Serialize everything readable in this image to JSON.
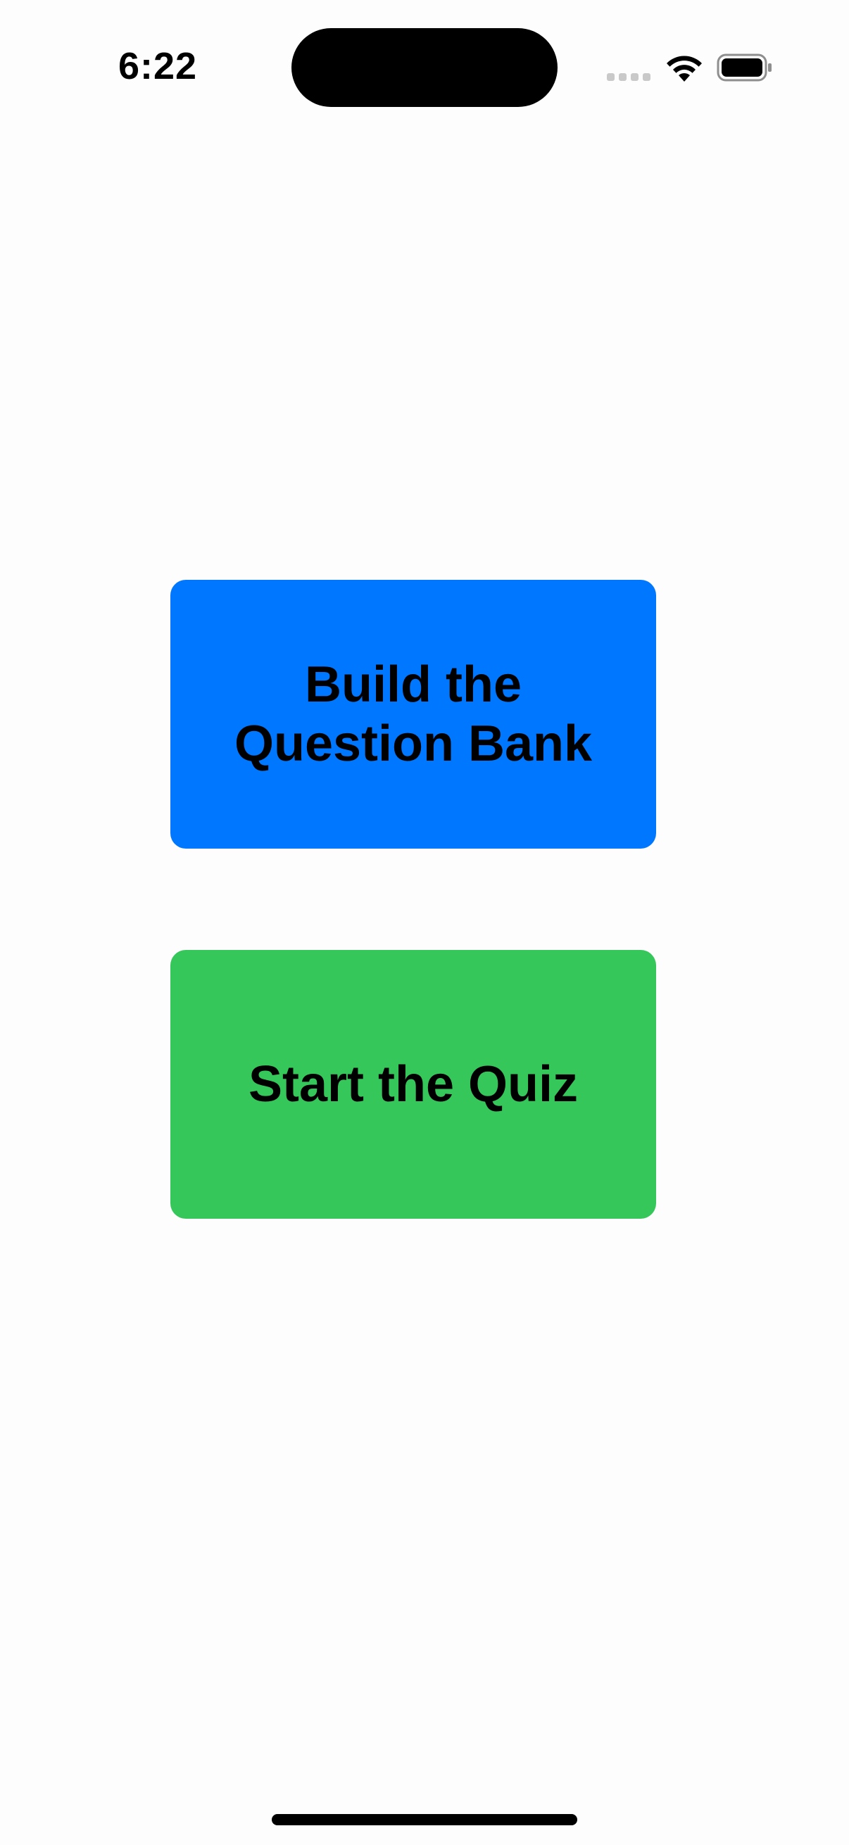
{
  "status_bar": {
    "time": "6:22",
    "icons": [
      "cellular-signal-icon",
      "wifi-icon",
      "battery-icon"
    ]
  },
  "main": {
    "build_button_label": "Build the Question Bank",
    "quiz_button_label": "Start the Quiz"
  },
  "colors": {
    "build_button": "#0077ff",
    "quiz_button": "#35c75a",
    "background": "#fdfdfd"
  }
}
